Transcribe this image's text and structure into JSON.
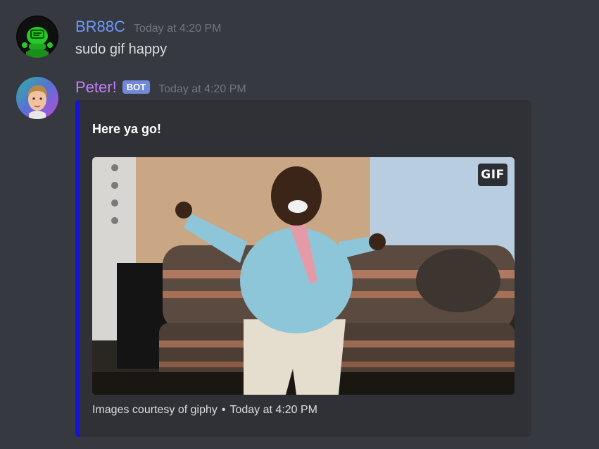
{
  "messages": [
    {
      "username": "BR88C",
      "username_color": "#6b98ff",
      "timestamp": "Today at 4:20 PM",
      "text": "sudo gif happy",
      "avatar_icon": "green-robot-icon"
    },
    {
      "username": "Peter!",
      "username_color": "#c77dff",
      "bot_tag": "BOT",
      "timestamp": "Today at 4:20 PM",
      "avatar_icon": "boy-face-icon",
      "embed": {
        "accent_color": "#1414d9",
        "description": "Here ya go!",
        "image_badge": "GIF",
        "image_icon": "dancing-man-gif",
        "footer_text": "Images courtesy of giphy",
        "footer_separator": "•",
        "footer_timestamp": "Today at 4:20 PM"
      }
    }
  ]
}
